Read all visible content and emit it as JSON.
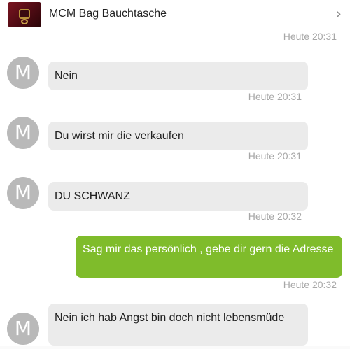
{
  "header": {
    "title": "MCM Bag Bauchtasche",
    "thumbnail_icon": "bag-thumbnail",
    "chevron_icon": "chevron-right-icon",
    "chevron_glyph": "›"
  },
  "conversation": {
    "top_timestamp": "Heute 20:31",
    "messages": [
      {
        "direction": "incoming",
        "avatar": "M",
        "text": "Nein",
        "time": "Heute 20:31"
      },
      {
        "direction": "incoming",
        "avatar": "M",
        "text": "Du wirst mir die verkaufen",
        "time": "Heute 20:31"
      },
      {
        "direction": "incoming",
        "avatar": "M",
        "text": "DU SCHWANZ",
        "time": "Heute 20:32"
      },
      {
        "direction": "outgoing",
        "text": "Sag mir das persönlich , gebe dir gern die Adresse",
        "time": "Heute 20:32"
      },
      {
        "direction": "incoming",
        "avatar": "M",
        "text": "Nein ich hab Angst bin doch nicht lebensmüde"
      }
    ]
  },
  "colors": {
    "incoming_bubble": "#ebebeb",
    "outgoing_bubble": "#7fbc2b",
    "avatar": "#b9b9b9",
    "timestamp": "#a7a7a7"
  }
}
